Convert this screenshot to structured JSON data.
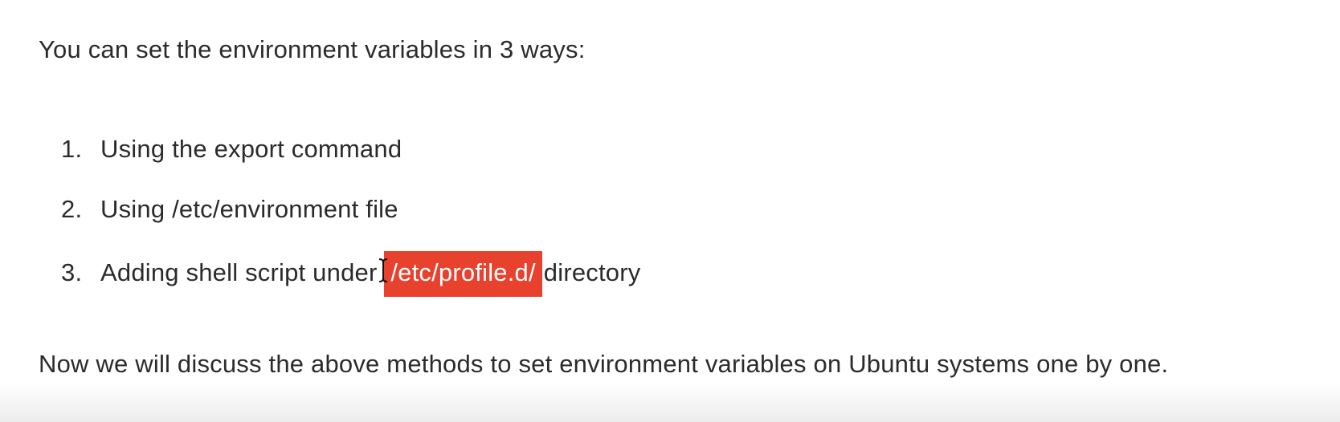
{
  "intro_text": "You can set the environment variables in 3 ways:",
  "list": [
    {
      "number": "1.",
      "text": "Using the export command"
    },
    {
      "number": "2.",
      "text": "Using /etc/environment file"
    },
    {
      "number": "3.",
      "text_before": "Adding shell script under",
      "highlight": "/etc/profile.d/",
      "text_after": "directory"
    }
  ],
  "outro_text": "Now we will discuss the above methods to set environment variables on Ubuntu systems one by one.",
  "colors": {
    "text": "#2b2b2b",
    "highlight_bg": "#e8422f",
    "highlight_text": "#ffffff"
  },
  "icons": {
    "cursor": "text-cursor-icon"
  }
}
